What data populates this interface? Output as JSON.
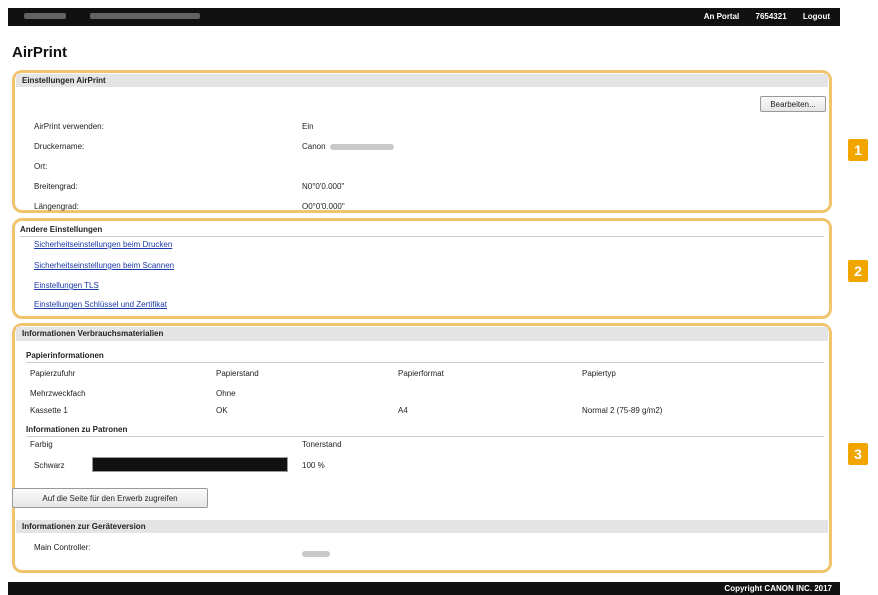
{
  "header": {
    "portal": "An Portal",
    "user": "7654321",
    "logout": "Logout"
  },
  "page": {
    "title": "AirPrint"
  },
  "airprint": {
    "title": "Einstellungen AirPrint",
    "edit_button": "Bearbeiten...",
    "labels": [
      "AirPrint verwenden:",
      "Druckername:",
      "Ort:",
      "Breitengrad:",
      "Längengrad:"
    ],
    "values": [
      "Ein",
      "Canon",
      "",
      "N0°0'0.000\"",
      "O0°0'0.000\""
    ]
  },
  "other": {
    "title": "Andere Einstellungen",
    "links": [
      "Sicherheitseinstellungen beim Drucken",
      "Sicherheitseinstellungen beim Scannen",
      "Einstellungen TLS",
      "Einstellungen Schlüssel und Zertifikat"
    ]
  },
  "consumables": {
    "title": "Informationen Verbrauchsmaterialien",
    "paper": {
      "title": "Papierinformationen",
      "headers": [
        "Papierzufuhr",
        "Papierstand",
        "Papierformat",
        "Papiertyp"
      ],
      "rows": [
        [
          "Mehrzweckfach",
          "Ohne",
          "",
          ""
        ],
        [
          "Kassette 1",
          "OK",
          "A4",
          "Normal 2 (75-89 g/m2)"
        ]
      ]
    },
    "cartridge": {
      "title": "Informationen zu Patronen",
      "headers": [
        "Farbig",
        "Tonerstand"
      ],
      "color": "Schwarz",
      "level_percent": 100,
      "level_label": "100 %"
    },
    "purchase_button": "Auf die Seite für den Erwerb zugreifen"
  },
  "device": {
    "title": "Informationen zur Geräteversion",
    "label": "Main Controller:"
  },
  "footer": {
    "copyright": "Copyright CANON INC. 2017"
  },
  "badges": [
    "1",
    "2",
    "3"
  ],
  "colors": {
    "highlight": "#f0c36d",
    "badge": "#f0a500",
    "link": "#1a3aa8",
    "bar": "#111111"
  }
}
